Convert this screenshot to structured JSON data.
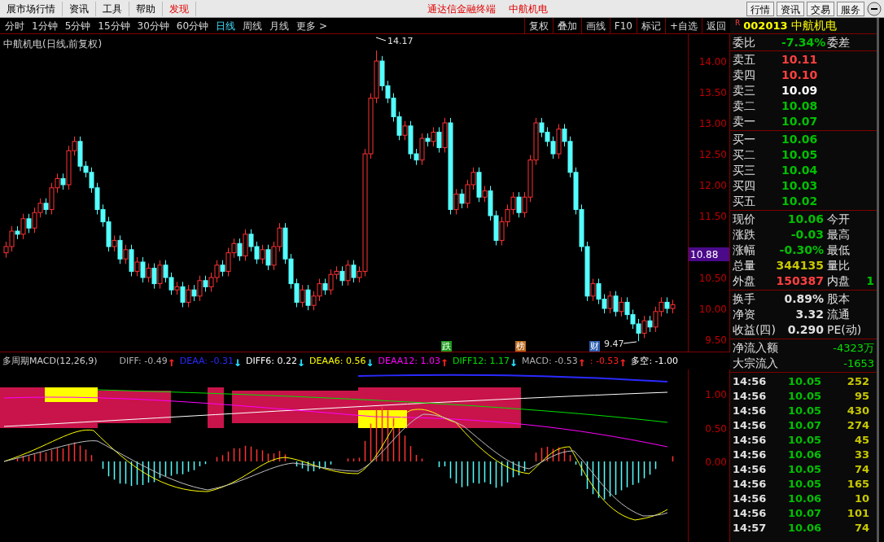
{
  "menu_bar": {
    "items": [
      {
        "label": "展市场行情",
        "highlight": false
      },
      {
        "label": "资讯",
        "highlight": false
      },
      {
        "label": "工具",
        "highlight": false
      },
      {
        "label": "帮助",
        "highlight": false
      },
      {
        "label": "发现",
        "highlight": true
      }
    ],
    "app_title": "通达信金融终端",
    "stock_title": "中航机电",
    "buttons": [
      "行情",
      "资讯",
      "交易",
      "服务"
    ]
  },
  "period_tabs": [
    {
      "label": "分时",
      "selected": false
    },
    {
      "label": "1分钟",
      "selected": false
    },
    {
      "label": "5分钟",
      "selected": false
    },
    {
      "label": "15分钟",
      "selected": false
    },
    {
      "label": "30分钟",
      "selected": false
    },
    {
      "label": "60分钟",
      "selected": false
    },
    {
      "label": "日线",
      "selected": true
    },
    {
      "label": "周线",
      "selected": false
    },
    {
      "label": "月线",
      "selected": false
    },
    {
      "label": "更多 >",
      "selected": false
    }
  ],
  "tool_buttons": [
    "复权",
    "叠加",
    "画线",
    "F10",
    "标记",
    "+自选",
    "返回"
  ],
  "price_chart": {
    "title": "中航机电(日线,前复权)",
    "chart_data": {
      "type": "candlestick",
      "ohlc": [
        [
          10.9,
          11.08,
          10.82,
          11.0
        ],
        [
          11.0,
          11.33,
          10.92,
          11.25
        ],
        [
          11.25,
          11.33,
          11.12,
          11.2
        ],
        [
          11.2,
          11.53,
          11.12,
          11.45
        ],
        [
          11.45,
          11.53,
          11.22,
          11.3
        ],
        [
          11.3,
          11.63,
          11.22,
          11.55
        ],
        [
          11.55,
          11.78,
          11.47,
          11.7
        ],
        [
          11.7,
          11.78,
          11.52,
          11.6
        ],
        [
          11.6,
          12.03,
          11.52,
          11.95
        ],
        [
          11.95,
          12.18,
          11.87,
          12.1
        ],
        [
          12.1,
          12.18,
          11.92,
          12.0
        ],
        [
          12.0,
          12.63,
          11.92,
          12.55
        ],
        [
          12.55,
          12.78,
          12.47,
          12.7
        ],
        [
          12.7,
          12.78,
          12.22,
          12.3
        ],
        [
          12.3,
          12.38,
          12.12,
          12.2
        ],
        [
          12.2,
          12.28,
          11.87,
          11.95
        ],
        [
          11.95,
          12.03,
          11.52,
          11.6
        ],
        [
          11.6,
          11.68,
          11.32,
          11.4
        ],
        [
          11.4,
          11.48,
          10.92,
          11.0
        ],
        [
          11.0,
          11.18,
          10.92,
          11.1
        ],
        [
          11.1,
          11.18,
          10.72,
          10.8
        ],
        [
          10.8,
          11.03,
          10.72,
          10.95
        ],
        [
          10.95,
          11.03,
          10.52,
          10.6
        ],
        [
          10.6,
          10.83,
          10.52,
          10.75
        ],
        [
          10.75,
          10.83,
          10.42,
          10.5
        ],
        [
          10.5,
          10.73,
          10.42,
          10.65
        ],
        [
          10.65,
          10.73,
          10.32,
          10.4
        ],
        [
          10.4,
          10.78,
          10.32,
          10.7
        ],
        [
          10.7,
          10.78,
          10.42,
          10.5
        ],
        [
          10.5,
          10.58,
          10.22,
          10.3
        ],
        [
          10.3,
          10.43,
          10.22,
          10.35
        ],
        [
          10.35,
          10.43,
          10.02,
          10.1
        ],
        [
          10.1,
          10.38,
          10.02,
          10.3
        ],
        [
          10.3,
          10.38,
          10.12,
          10.2
        ],
        [
          10.2,
          10.53,
          10.12,
          10.45
        ],
        [
          10.45,
          10.53,
          10.27,
          10.35
        ],
        [
          10.35,
          10.58,
          10.27,
          10.5
        ],
        [
          10.5,
          10.78,
          10.42,
          10.7
        ],
        [
          10.7,
          10.78,
          10.52,
          10.6
        ],
        [
          10.6,
          10.98,
          10.52,
          10.9
        ],
        [
          10.9,
          11.13,
          10.82,
          11.05
        ],
        [
          11.05,
          11.13,
          10.77,
          10.85
        ],
        [
          10.85,
          11.28,
          10.77,
          11.2
        ],
        [
          11.2,
          11.28,
          10.92,
          11.0
        ],
        [
          11.0,
          11.08,
          10.72,
          10.8
        ],
        [
          10.8,
          11.03,
          10.72,
          10.95
        ],
        [
          10.95,
          11.03,
          10.62,
          10.7
        ],
        [
          10.7,
          11.08,
          10.62,
          11.0
        ],
        [
          11.0,
          11.38,
          10.92,
          11.3
        ],
        [
          11.3,
          11.38,
          10.72,
          10.8
        ],
        [
          10.8,
          10.88,
          10.32,
          10.4
        ],
        [
          10.4,
          10.48,
          10.02,
          10.1
        ],
        [
          10.1,
          10.38,
          10.02,
          10.3
        ],
        [
          10.3,
          10.38,
          9.97,
          10.05
        ],
        [
          10.05,
          10.28,
          9.97,
          10.2
        ],
        [
          10.2,
          10.48,
          10.12,
          10.4
        ],
        [
          10.4,
          10.48,
          10.22,
          10.3
        ],
        [
          10.3,
          10.63,
          10.22,
          10.55
        ],
        [
          10.55,
          10.68,
          10.47,
          10.6
        ],
        [
          10.6,
          10.68,
          10.37,
          10.45
        ],
        [
          10.45,
          10.78,
          10.37,
          10.7
        ],
        [
          10.7,
          10.78,
          10.42,
          10.5
        ],
        [
          10.5,
          10.68,
          10.42,
          10.6
        ],
        [
          10.6,
          12.58,
          10.52,
          12.5
        ],
        [
          12.5,
          13.48,
          12.42,
          13.4
        ],
        [
          13.4,
          14.17,
          13.32,
          14.0
        ],
        [
          14.0,
          14.08,
          13.52,
          13.6
        ],
        [
          13.6,
          13.68,
          13.32,
          13.4
        ],
        [
          13.4,
          13.48,
          13.02,
          13.1
        ],
        [
          13.1,
          13.18,
          12.72,
          12.8
        ],
        [
          12.8,
          13.03,
          12.72,
          12.95
        ],
        [
          12.95,
          13.03,
          12.42,
          12.5
        ],
        [
          12.5,
          12.58,
          12.32,
          12.4
        ],
        [
          12.4,
          12.83,
          12.32,
          12.75
        ],
        [
          12.75,
          12.83,
          12.62,
          12.7
        ],
        [
          12.7,
          12.93,
          12.62,
          12.85
        ],
        [
          12.85,
          12.93,
          12.52,
          12.6
        ],
        [
          12.6,
          13.08,
          12.52,
          13.0
        ],
        [
          13.0,
          13.08,
          11.52,
          11.6
        ],
        [
          11.6,
          11.93,
          11.52,
          11.85
        ],
        [
          11.85,
          11.93,
          11.62,
          11.7
        ],
        [
          11.7,
          12.08,
          11.62,
          12.0
        ],
        [
          12.0,
          12.28,
          11.92,
          12.2
        ],
        [
          12.2,
          12.28,
          11.72,
          11.8
        ],
        [
          11.8,
          11.98,
          11.72,
          11.9
        ],
        [
          11.9,
          11.98,
          11.42,
          11.5
        ],
        [
          11.5,
          11.58,
          11.02,
          11.1
        ],
        [
          11.1,
          11.48,
          11.02,
          11.4
        ],
        [
          11.4,
          11.68,
          11.32,
          11.6
        ],
        [
          11.6,
          11.88,
          11.52,
          11.8
        ],
        [
          11.8,
          11.88,
          11.47,
          11.55
        ],
        [
          11.55,
          11.88,
          11.47,
          11.8
        ],
        [
          11.8,
          12.48,
          11.72,
          12.4
        ],
        [
          12.4,
          13.08,
          12.32,
          13.0
        ],
        [
          13.0,
          13.08,
          12.77,
          12.85
        ],
        [
          12.85,
          12.93,
          12.62,
          12.7
        ],
        [
          12.7,
          12.78,
          12.42,
          12.5
        ],
        [
          12.5,
          12.98,
          12.42,
          12.9
        ],
        [
          12.9,
          12.98,
          12.62,
          12.7
        ],
        [
          12.7,
          12.78,
          12.12,
          12.2
        ],
        [
          12.2,
          12.28,
          11.52,
          11.6
        ],
        [
          11.6,
          11.68,
          10.92,
          11.0
        ],
        [
          11.0,
          11.08,
          10.12,
          10.2
        ],
        [
          10.2,
          10.48,
          10.12,
          10.4
        ],
        [
          10.4,
          10.48,
          10.07,
          10.15
        ],
        [
          10.15,
          10.23,
          9.92,
          10.0
        ],
        [
          10.0,
          10.28,
          9.92,
          10.2
        ],
        [
          10.2,
          10.28,
          9.87,
          9.95
        ],
        [
          9.95,
          10.18,
          9.87,
          10.1
        ],
        [
          10.1,
          10.18,
          9.82,
          9.9
        ],
        [
          9.9,
          9.98,
          9.67,
          9.75
        ],
        [
          9.75,
          9.83,
          9.47,
          9.6
        ],
        [
          9.6,
          9.88,
          9.52,
          9.8
        ],
        [
          9.8,
          9.88,
          9.62,
          9.7
        ],
        [
          9.7,
          10.03,
          9.62,
          9.95
        ],
        [
          9.95,
          10.18,
          9.87,
          10.1
        ],
        [
          10.1,
          10.18,
          9.92,
          10.0
        ],
        [
          10.0,
          10.14,
          9.92,
          10.06
        ]
      ]
    },
    "y_axis": [
      "14.00",
      "13.50",
      "13.00",
      "12.50",
      "12.00",
      "11.50",
      "10.50",
      "10.00",
      "9.50"
    ],
    "current_price_tag": "10.88",
    "high_label": "14.17",
    "low_label": "9.47",
    "markers": [
      {
        "label": "跌",
        "color": "#1a9a1a"
      },
      {
        "label": "榜",
        "color": "#b8651a"
      },
      {
        "label": "财",
        "color": "#2a5db0"
      }
    ]
  },
  "indicator": {
    "name": "多周期MACD(12,26,9)",
    "values": [
      {
        "label": "DIFF: -0.49",
        "color": "#b0b0b0",
        "arrow": {
          "symbol": "↑",
          "color": "#ff2020"
        }
      },
      {
        "label": "DEAA: -0.31",
        "color": "#2a2aff",
        "arrow": {
          "symbol": "↓",
          "color": "#20e0ff"
        }
      },
      {
        "label": "DIFF6: 0.22",
        "color": "#ffffff",
        "arrow": {
          "symbol": "↓",
          "color": "#20e0ff"
        }
      },
      {
        "label": "DEAA6: 0.56",
        "color": "#ffff00",
        "arrow": {
          "symbol": "↓",
          "color": "#20e0ff"
        }
      },
      {
        "label": "DEAA12: 1.03",
        "color": "#ff00ff",
        "arrow": {
          "symbol": "↑",
          "color": "#ff2020"
        }
      },
      {
        "label": "DIFF12: 1.17",
        "color": "#00e000",
        "arrow": {
          "symbol": "↓",
          "color": "#20e0ff"
        }
      },
      {
        "label": "MACD: -0.53",
        "color": "#b0b0b0",
        "arrow": {
          "symbol": "↑",
          "color": "#ff2020"
        }
      },
      {
        "label": ": -0.53",
        "color": "#ff2020",
        "arrow": {
          "symbol": "↑",
          "color": "#ff2020"
        }
      },
      {
        "label": "多空: -1.00",
        "color": "#ffffff"
      }
    ],
    "y_axis": [
      "1.00",
      "0.50",
      "0.00"
    ]
  },
  "quote_panel": {
    "flag": "R",
    "code": "002013",
    "name": "中航机电",
    "ratio": {
      "label": "委比",
      "value": "-7.34%",
      "label2": "委差"
    },
    "asks": [
      {
        "label": "卖五",
        "price": "10.11",
        "color": "#ff4040"
      },
      {
        "label": "卖四",
        "price": "10.10",
        "color": "#ff4040"
      },
      {
        "label": "卖三",
        "price": "10.09",
        "color": "#ffffff"
      },
      {
        "label": "卖二",
        "price": "10.08",
        "color": "#00c000"
      },
      {
        "label": "卖一",
        "price": "10.07",
        "color": "#00c000"
      }
    ],
    "bids": [
      {
        "label": "买一",
        "price": "10.06",
        "color": "#00c000"
      },
      {
        "label": "买二",
        "price": "10.05",
        "color": "#00c000"
      },
      {
        "label": "买三",
        "price": "10.04",
        "color": "#00c000"
      },
      {
        "label": "买四",
        "price": "10.03",
        "color": "#00c000"
      },
      {
        "label": "买五",
        "price": "10.02",
        "color": "#00c000"
      }
    ],
    "quotes": [
      {
        "label": "现价",
        "value": "10.06",
        "color": "#00c000",
        "label2": "今开"
      },
      {
        "label": "涨跌",
        "value": "-0.03",
        "color": "#00c000",
        "label2": "最高"
      },
      {
        "label": "涨幅",
        "value": "-0.30%",
        "color": "#00c000",
        "label2": "最低"
      },
      {
        "label": "总量",
        "value": "344135",
        "color": "#c8c800",
        "label2": "量比"
      },
      {
        "label": "外盘",
        "value": "150387",
        "color": "#ff4040",
        "label2": "内盘",
        "value2": "1"
      }
    ],
    "stats": [
      {
        "label": "换手",
        "value": "0.89%",
        "label2": "股本"
      },
      {
        "label": "净资",
        "value": "3.32",
        "label2": "流通"
      },
      {
        "label": "收益(四)",
        "value": "0.290",
        "label2": "PE(动)"
      }
    ],
    "flows": [
      {
        "label": "净流入额",
        "value": "-4323万"
      },
      {
        "label": "大宗流入",
        "value": "-1653"
      }
    ],
    "trades": [
      {
        "time": "14:56",
        "price": "10.05",
        "volume": "252"
      },
      {
        "time": "14:56",
        "price": "10.05",
        "volume": "95"
      },
      {
        "time": "14:56",
        "price": "10.05",
        "volume": "430"
      },
      {
        "time": "14:56",
        "price": "10.07",
        "volume": "274"
      },
      {
        "time": "14:56",
        "price": "10.05",
        "volume": "45"
      },
      {
        "time": "14:56",
        "price": "10.06",
        "volume": "33"
      },
      {
        "time": "14:56",
        "price": "10.05",
        "volume": "74"
      },
      {
        "time": "14:56",
        "price": "10.05",
        "volume": "165"
      },
      {
        "time": "14:56",
        "price": "10.06",
        "volume": "10"
      },
      {
        "time": "14:56",
        "price": "10.07",
        "volume": "101"
      },
      {
        "time": "14:57",
        "price": "10.06",
        "volume": "74"
      }
    ]
  }
}
